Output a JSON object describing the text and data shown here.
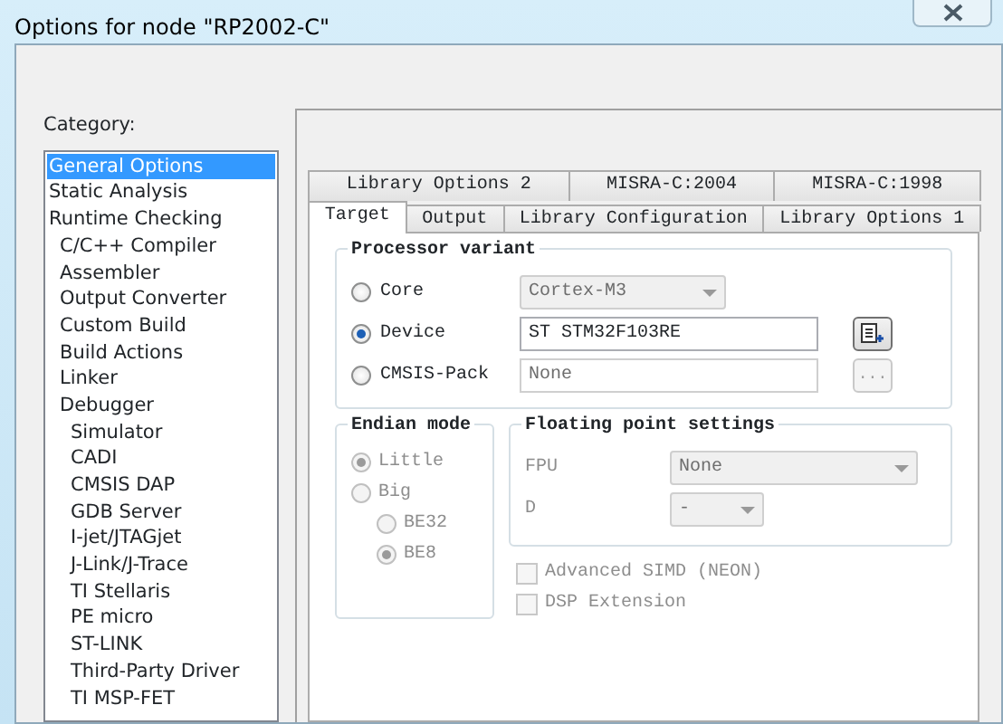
{
  "window": {
    "title": "Options for node \"RP2002-C\""
  },
  "category": {
    "label": "Category:",
    "items": [
      {
        "label": "General Options",
        "selected": true
      },
      {
        "label": "Static Analysis",
        "selected": false
      },
      {
        "label": "Runtime Checking",
        "selected": false,
        "children": [
          {
            "label": "C/C++ Compiler",
            "selected": false
          },
          {
            "label": "Assembler",
            "selected": false
          },
          {
            "label": "Output Converter",
            "selected": false
          },
          {
            "label": "Custom Build",
            "selected": false
          },
          {
            "label": "Build Actions",
            "selected": false
          },
          {
            "label": "Linker",
            "selected": false
          },
          {
            "label": "Debugger",
            "selected": false,
            "children": [
              {
                "label": "Simulator",
                "selected": false
              },
              {
                "label": "CADI",
                "selected": false
              },
              {
                "label": "CMSIS DAP",
                "selected": false
              },
              {
                "label": "GDB Server",
                "selected": false
              },
              {
                "label": "I-jet/JTAGjet",
                "selected": false
              },
              {
                "label": "J-Link/J-Trace",
                "selected": false
              },
              {
                "label": "TI Stellaris",
                "selected": false
              },
              {
                "label": "PE micro",
                "selected": false
              },
              {
                "label": "ST-LINK",
                "selected": false
              },
              {
                "label": "Third-Party Driver",
                "selected": false
              },
              {
                "label": "TI MSP-FET",
                "selected": false
              }
            ]
          }
        ]
      }
    ]
  },
  "tab_rows": [
    [
      {
        "label": "Library Options 2",
        "selected": false
      },
      {
        "label": "MISRA-C:2004",
        "selected": false
      },
      {
        "label": "MISRA-C:1998",
        "selected": false
      }
    ],
    [
      {
        "label": "Target",
        "selected": true
      },
      {
        "label": "Output",
        "selected": false
      },
      {
        "label": "Library Configuration",
        "selected": false
      },
      {
        "label": "Library Options 1",
        "selected": false
      }
    ]
  ],
  "processor_variant": {
    "title": "Processor variant",
    "options": [
      {
        "label": "Core",
        "selected": false,
        "field": {
          "kind": "combo",
          "value": "Cortex-M3",
          "disabled": true
        }
      },
      {
        "label": "Device",
        "selected": true,
        "field": {
          "kind": "text",
          "value": "ST STM32F103RE",
          "disabled": false
        },
        "button": {
          "kind": "icon",
          "disabled": false
        }
      },
      {
        "label": "CMSIS-Pack",
        "selected": false,
        "field": {
          "kind": "text",
          "value": "None",
          "disabled": true
        },
        "button": {
          "kind": "text",
          "label": "...",
          "disabled": true
        }
      }
    ]
  },
  "endian_mode": {
    "title": "Endian mode",
    "options": [
      {
        "label": "Little",
        "selected": true,
        "disabled": true
      },
      {
        "label": "Big",
        "selected": false,
        "disabled": true,
        "children": [
          {
            "label": "BE32",
            "selected": false,
            "disabled": true
          },
          {
            "label": "BE8",
            "selected": true,
            "disabled": true
          }
        ]
      }
    ]
  },
  "floating_point": {
    "title": "Floating point settings",
    "fields": [
      {
        "label": "FPU",
        "value": "None",
        "disabled": true
      },
      {
        "label": "D",
        "value": "-",
        "disabled": true
      }
    ]
  },
  "checkboxes": [
    {
      "label": "Advanced SIMD (NEON)",
      "checked": false,
      "disabled": true
    },
    {
      "label": "DSP Extension",
      "checked": false,
      "disabled": true
    }
  ]
}
